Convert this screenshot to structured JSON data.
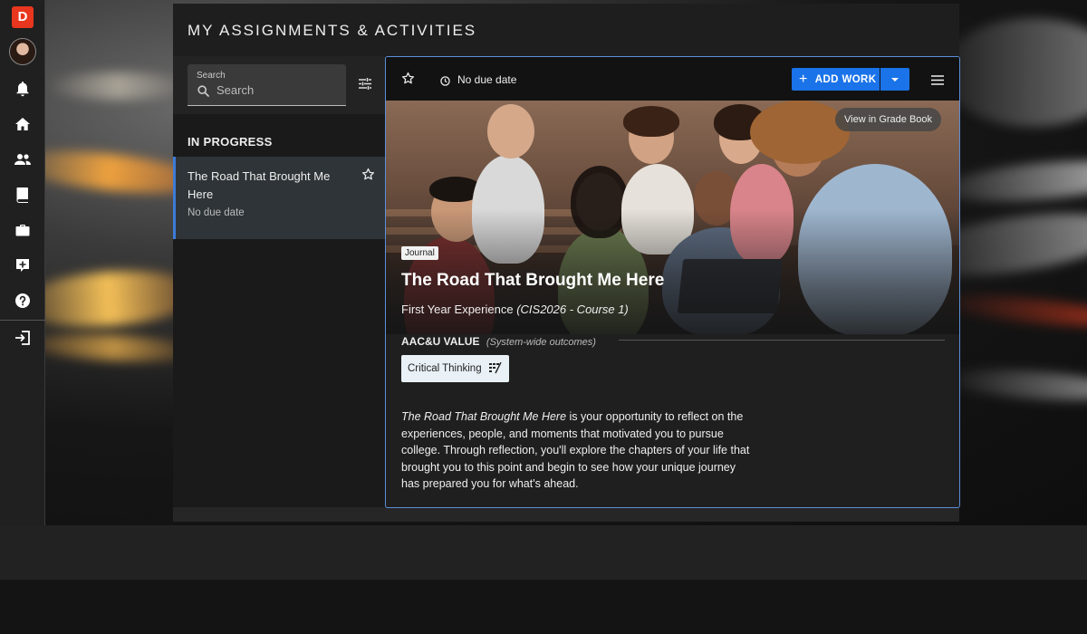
{
  "nav": {
    "logo_letter": "D",
    "icons": [
      "bell-icon",
      "home-icon",
      "people-icon",
      "book-icon",
      "briefcase-icon",
      "add-note-icon",
      "help-icon",
      "logout-icon"
    ]
  },
  "page": {
    "title": "MY ASSIGNMENTS & ACTIVITIES"
  },
  "search": {
    "label": "Search",
    "placeholder": "Search",
    "value": ""
  },
  "list": {
    "section_header": "IN PROGRESS",
    "items": [
      {
        "title": "The Road That Brought Me Here",
        "due": "No due date",
        "starred": false
      }
    ]
  },
  "detail": {
    "due": "No due date",
    "add_work_label": "ADD WORK",
    "grade_book_label": "View in Grade Book",
    "tag": "Journal",
    "title": "The Road That Brought Me Here",
    "course_name": "First Year Experience",
    "course_code": "(CIS2026 - Course 1)",
    "aacu_title": "AAC&U VALUE",
    "aacu_note": "(System-wide outcomes)",
    "chip_label": "Critical Thinking",
    "description_lead": "The Road That Brought Me Here",
    "description_rest": " is your opportunity to reflect on the experiences, people, and moments that motivated you to pursue college. Through reflection, you'll explore the chapters of your life that brought you to this point and begin to see how your unique journey has prepared you for what's ahead."
  },
  "colors": {
    "accent": "#1a73e8",
    "logo": "#e8371e",
    "selected_border": "#3d7bd6",
    "card_border": "#5b8fd8"
  }
}
